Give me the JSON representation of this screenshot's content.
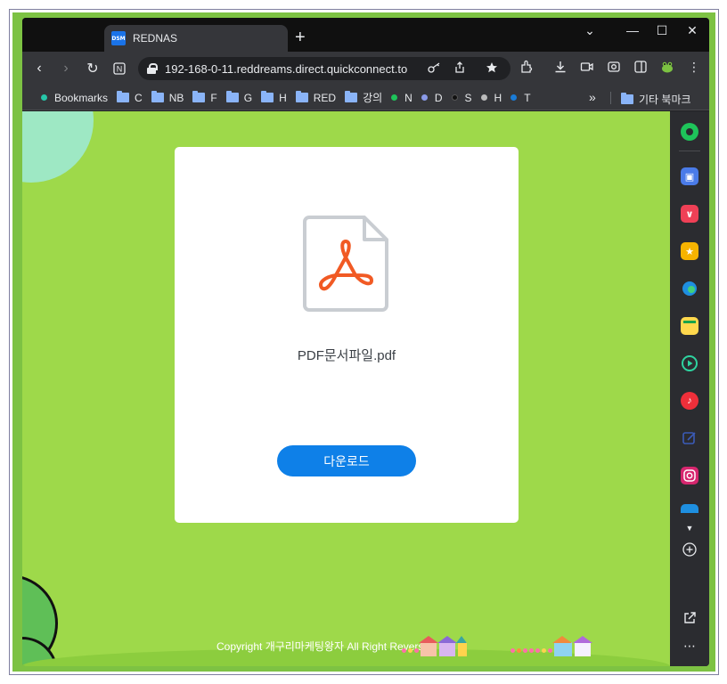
{
  "tab": {
    "favicon_text": "DSM",
    "title": "REDNAS",
    "new_tab": "+"
  },
  "window_controls": {
    "dropdown": "⌄",
    "minimize": "—",
    "maximize": "☐",
    "close": "✕"
  },
  "toolbar": {
    "url": "192-168-0-11.reddreams.direct.quickconnect.to"
  },
  "bookmarks": {
    "items": [
      {
        "label": "Bookmarks",
        "type": "dot",
        "color": "#26c6a8"
      },
      {
        "label": "C",
        "type": "folder"
      },
      {
        "label": "NB",
        "type": "folder"
      },
      {
        "label": "F",
        "type": "folder"
      },
      {
        "label": "G",
        "type": "folder"
      },
      {
        "label": "H",
        "type": "folder"
      },
      {
        "label": "RED",
        "type": "folder"
      },
      {
        "label": "강의",
        "type": "folder"
      },
      {
        "label": "N",
        "type": "dot",
        "color": "#1ec45a"
      },
      {
        "label": "D",
        "type": "dot",
        "color": "#8a9ae8"
      },
      {
        "label": "S",
        "type": "dot",
        "color": "#111111"
      },
      {
        "label": "H",
        "type": "dot",
        "color": "#bbbbbb"
      },
      {
        "label": "T",
        "type": "dot",
        "color": "#1a7bd6"
      }
    ],
    "overflow": "»",
    "other_folder": "기타 북마크"
  },
  "page": {
    "filename": "PDF문서파일.pdf",
    "download_label": "다운로드",
    "copyright": "Copyright 개구리마케팅왕자 All Right Reversed"
  },
  "colors": {
    "content_bg": "#9ed94a",
    "button": "#0e80e8",
    "pdf_accent": "#f15a24"
  }
}
